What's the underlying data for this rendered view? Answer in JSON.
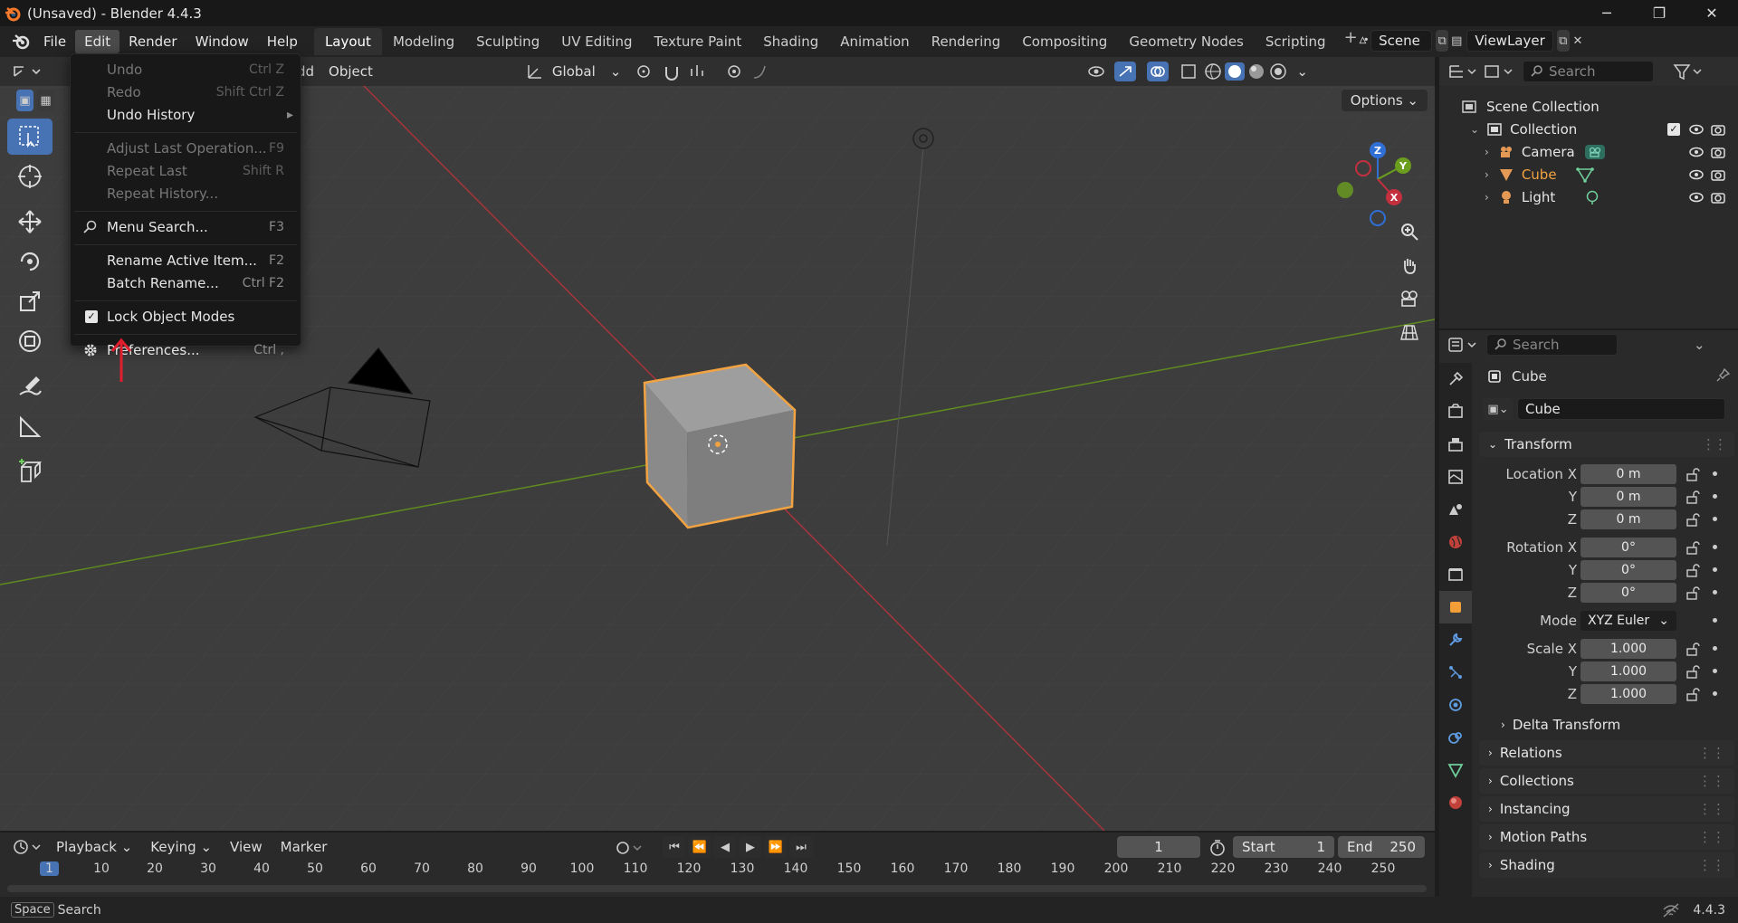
{
  "window": {
    "title": "(Unsaved) - Blender 4.4.3",
    "controls": [
      "─",
      "❐",
      "✕"
    ]
  },
  "menubar": {
    "items": [
      "File",
      "Edit",
      "Render",
      "Window",
      "Help"
    ],
    "active": "Edit"
  },
  "workspaces": {
    "tabs": [
      "Layout",
      "Modeling",
      "Sculpting",
      "UV Editing",
      "Texture Paint",
      "Shading",
      "Animation",
      "Rendering",
      "Compositing",
      "Geometry Nodes",
      "Scripting"
    ],
    "active": "Layout",
    "add": "+"
  },
  "scene": {
    "scene_name": "Scene",
    "view_layer": "ViewLayer"
  },
  "viewport": {
    "header_items": [
      "dd",
      "Object"
    ],
    "orientation": "Global",
    "options_label": "Options",
    "gizmo": {
      "x": "X",
      "y": "Y",
      "z": "Z"
    }
  },
  "edit_menu": {
    "items": [
      {
        "label": "Undo",
        "shortcut": "Ctrl Z",
        "disabled": true
      },
      {
        "label": "Redo",
        "shortcut": "Shift Ctrl Z",
        "disabled": true
      },
      {
        "label": "Undo History",
        "shortcut": "▸",
        "disabled": false
      },
      {
        "label": "Adjust Last Operation...",
        "shortcut": "F9",
        "disabled": true
      },
      {
        "label": "Repeat Last",
        "shortcut": "Shift R",
        "disabled": true
      },
      {
        "label": "Repeat History...",
        "shortcut": "",
        "disabled": true
      },
      {
        "label": "Menu Search...",
        "shortcut": "F3",
        "disabled": false
      },
      {
        "label": "Rename Active Item...",
        "shortcut": "F2",
        "disabled": false
      },
      {
        "label": "Batch Rename...",
        "shortcut": "Ctrl F2",
        "disabled": false
      },
      {
        "label": "Lock Object Modes",
        "shortcut": "",
        "disabled": false
      },
      {
        "label": "Preferences...",
        "shortcut": "Ctrl ,",
        "disabled": false
      }
    ]
  },
  "outliner": {
    "search_placeholder": "Search",
    "rows": [
      "Scene Collection",
      "Collection",
      "Camera",
      "Cube",
      "Light"
    ]
  },
  "properties": {
    "search_placeholder": "Search",
    "object_name": "Cube",
    "datablock_name": "Cube",
    "panels": {
      "transform": "Transform",
      "delta": "Delta Transform",
      "relations": "Relations",
      "collections": "Collections",
      "instancing": "Instancing",
      "motion_paths": "Motion Paths",
      "shading": "Shading"
    },
    "rows": [
      {
        "label": "Location X",
        "value": "0 m"
      },
      {
        "label": "Y",
        "value": "0 m"
      },
      {
        "label": "Z",
        "value": "0 m"
      },
      {
        "label": "Rotation X",
        "value": "0°"
      },
      {
        "label": "Y",
        "value": "0°"
      },
      {
        "label": "Z",
        "value": "0°"
      },
      {
        "label": "Mode",
        "value": "XYZ Euler"
      },
      {
        "label": "Scale X",
        "value": "1.000"
      },
      {
        "label": "Y",
        "value": "1.000"
      },
      {
        "label": "Z",
        "value": "1.000"
      }
    ]
  },
  "timeline": {
    "menus": [
      "Playback",
      "Keying",
      "View",
      "Marker"
    ],
    "current_frame": "1",
    "start_label": "Start",
    "start_value": "1",
    "end_label": "End",
    "end_value": "250",
    "ruler": [
      "10",
      "20",
      "30",
      "40",
      "50",
      "60",
      "70",
      "80",
      "90",
      "100",
      "110",
      "120",
      "130",
      "140",
      "150",
      "160",
      "170",
      "180",
      "190",
      "200",
      "210",
      "220",
      "230",
      "240",
      "250"
    ],
    "ruler_current": "1"
  },
  "statusbar": {
    "key": "Space",
    "action": "Search",
    "version": "4.4.3"
  },
  "colors": {
    "accent": "#4772b3",
    "selection": "#f2a341",
    "x_axis": "#c3303e",
    "y_axis": "#6b9e1f",
    "z_axis": "#2f6fd6"
  }
}
